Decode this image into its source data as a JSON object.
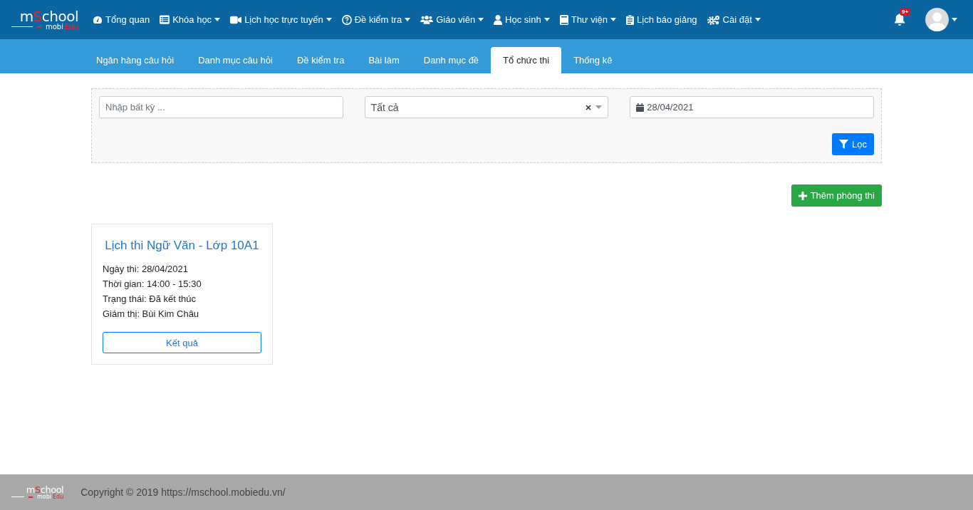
{
  "logo": {
    "name_parts": [
      "m",
      "S",
      "chool"
    ],
    "sub_parts": [
      "mobi",
      "Edu"
    ]
  },
  "nav": [
    {
      "label": "Tổng quan",
      "dropdown": false
    },
    {
      "label": "Khóa học",
      "dropdown": true
    },
    {
      "label": "Lịch học trực tuyến",
      "dropdown": true
    },
    {
      "label": "Đề kiểm tra",
      "dropdown": true
    },
    {
      "label": "Giáo viên",
      "dropdown": true
    },
    {
      "label": "Học sinh",
      "dropdown": true
    },
    {
      "label": "Thư viện",
      "dropdown": true
    },
    {
      "label": "Lịch báo giảng",
      "dropdown": false
    },
    {
      "label": "Cài đặt",
      "dropdown": true
    }
  ],
  "notifications": {
    "badge": "9+"
  },
  "tabs": [
    {
      "label": "Ngân hàng câu hỏi",
      "selected": false
    },
    {
      "label": "Danh mục câu hỏi",
      "selected": false
    },
    {
      "label": "Đề kiểm tra",
      "selected": false
    },
    {
      "label": "Bài làm",
      "selected": false
    },
    {
      "label": "Danh mục đề",
      "selected": false
    },
    {
      "label": "Tổ chức thi",
      "selected": true
    },
    {
      "label": "Thống kê",
      "selected": false
    }
  ],
  "filter": {
    "search": {
      "placeholder": "Nhập bất kỳ ..."
    },
    "status": {
      "value": "Tất cả"
    },
    "date": {
      "value": "28/04/2021"
    },
    "button": "Lọc"
  },
  "add_button": "Thêm phòng thi",
  "exams": [
    {
      "title": "Lịch thi Ngữ Văn - Lớp 10A1",
      "details": [
        "Ngày thi: 28/04/2021",
        "Thời gian: 14:00 - 15:30",
        "Trạng thái: Đã kết thúc",
        "Giám thị: Bùi Kim Châu"
      ],
      "button": "Kết quả"
    }
  ],
  "footer": {
    "logo": {
      "name_parts": [
        "m",
        "S",
        "chool"
      ],
      "sub_parts": [
        "mobi",
        "Edu"
      ]
    },
    "text": "Copyright © 2019 https://mschool.mobiedu.vn/"
  }
}
